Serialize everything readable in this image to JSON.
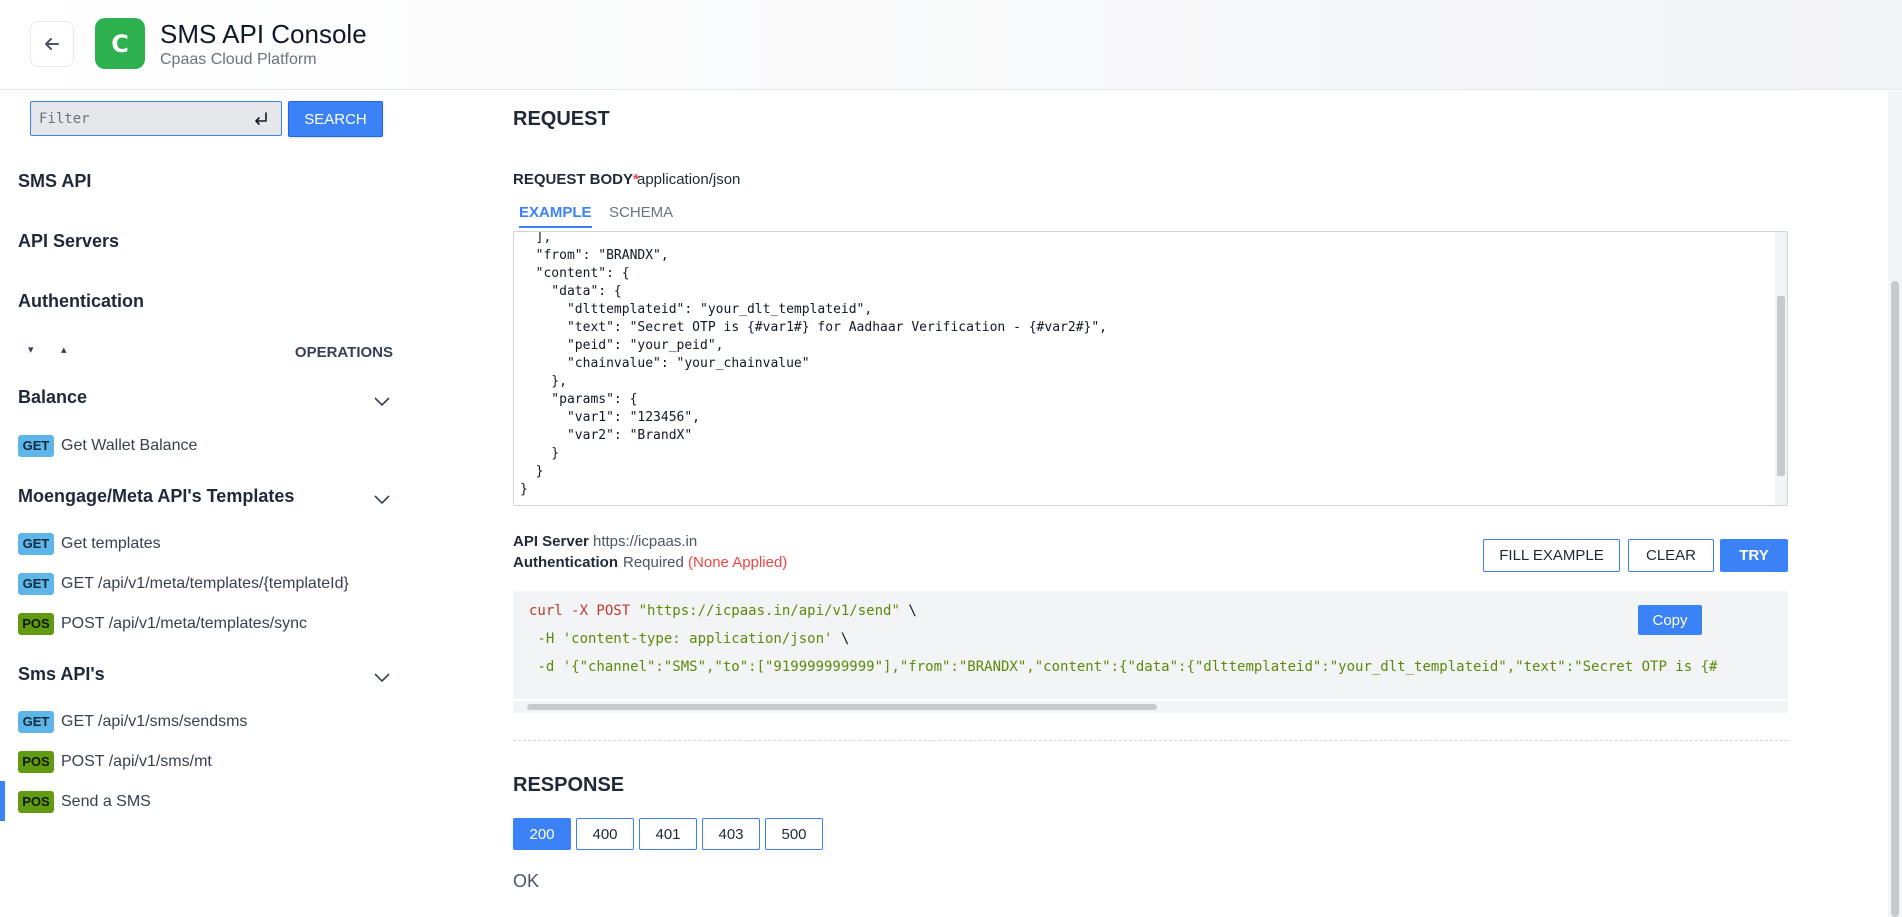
{
  "header": {
    "logo_letter": "C",
    "title": "SMS API Console",
    "subtitle": "Cpaas Cloud Platform"
  },
  "sidebar": {
    "filter_placeholder": "Filter",
    "search_label": "SEARCH",
    "sections": [
      "SMS API",
      "API Servers",
      "Authentication"
    ],
    "operations_label": "OPERATIONS",
    "expand_all": "▾",
    "collapse_all": "▴",
    "groups": [
      {
        "title": "Balance",
        "items": [
          {
            "method": "GET",
            "label": "Get Wallet Balance"
          }
        ]
      },
      {
        "title": "Moengage/Meta API's Templates",
        "items": [
          {
            "method": "GET",
            "label": "Get templates"
          },
          {
            "method": "GET",
            "label": "GET /api/v1/meta/templates/{templateId}"
          },
          {
            "method": "POS",
            "label": "POST /api/v1/meta/templates/sync"
          }
        ]
      },
      {
        "title": "Sms API's",
        "items": [
          {
            "method": "GET",
            "label": "GET /api/v1/sms/sendsms"
          },
          {
            "method": "POS",
            "label": "POST /api/v1/sms/mt"
          },
          {
            "method": "POS",
            "label": "Send a SMS",
            "active": true
          }
        ]
      }
    ]
  },
  "main": {
    "request_title": "REQUEST",
    "request_body_label": "REQUEST BODY",
    "required_star": "*",
    "content_type": "application/json",
    "tabs": [
      {
        "label": "EXAMPLE",
        "active": true
      },
      {
        "label": "SCHEMA",
        "active": false
      }
    ],
    "example_code": "  ],\n  \"from\": \"BRANDX\",\n  \"content\": {\n    \"data\": {\n      \"dlttemplateid\": \"your_dlt_templateid\",\n      \"text\": \"Secret OTP is {#var1#} for Aadhaar Verification - {#var2#}\",\n      \"peid\": \"your_peid\",\n      \"chainvalue\": \"your_chainvalue\"\n    },\n    \"params\": {\n      \"var1\": \"123456\",\n      \"var2\": \"BrandX\"\n    }\n  }\n}",
    "api_server_label": "API Server",
    "api_server_value": "https://icpaas.in",
    "auth_label": "Authentication",
    "auth_required": "Required",
    "auth_status": "(None Applied)",
    "buttons": {
      "fill_example": "FILL EXAMPLE",
      "clear": "CLEAR",
      "try": "TRY"
    },
    "curl": {
      "cmd": "curl -X POST",
      "url": "\"https://icpaas.in/api/v1/send\"",
      "cont": " \\",
      "header_line": " -H 'content-type: application/json'",
      "data_line": " -d '{\"channel\":\"SMS\",\"to\":[\"919999999999\"],\"from\":\"BRANDX\",\"content\":{\"data\":{\"dlttemplateid\":\"your_dlt_templateid\",\"text\":\"Secret OTP is {#",
      "copy_label": "Copy"
    },
    "response_title": "RESPONSE",
    "status_codes": [
      {
        "code": "200",
        "active": true
      },
      {
        "code": "400",
        "active": false
      },
      {
        "code": "401",
        "active": false
      },
      {
        "code": "403",
        "active": false
      },
      {
        "code": "500",
        "active": false
      }
    ],
    "response_text": "OK"
  }
}
